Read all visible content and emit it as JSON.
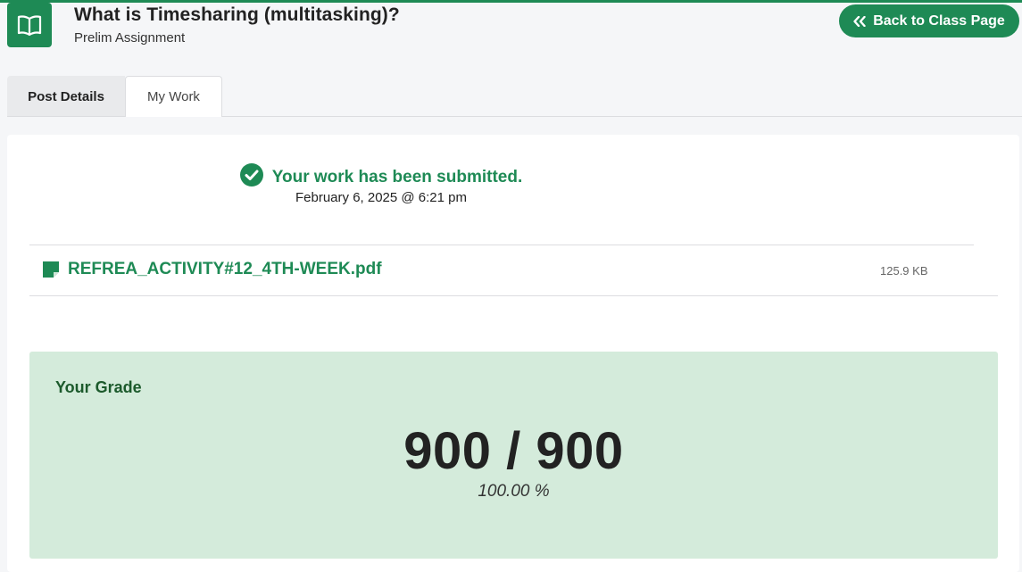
{
  "header": {
    "title": "What is Timesharing (multitasking)?",
    "subtitle": "Prelim Assignment",
    "back_label": "Back to Class Page"
  },
  "tabs": [
    {
      "label": "Post Details",
      "active": false
    },
    {
      "label": "My Work",
      "active": true
    }
  ],
  "submission": {
    "status": "Your work has been submitted.",
    "date": "February 6, 2025 @ 6:21 pm"
  },
  "file": {
    "name": "REFREA_ACTIVITY#12_4TH-WEEK.pdf",
    "size": "125.9 KB",
    "icon": "file-icon"
  },
  "grade": {
    "label": "Your Grade",
    "score": "900 / 900",
    "percent": "100.00 %"
  },
  "colors": {
    "accent": "#1e8a55",
    "grade_bg": "#d4ebdb",
    "grade_label": "#1c5a2c"
  }
}
